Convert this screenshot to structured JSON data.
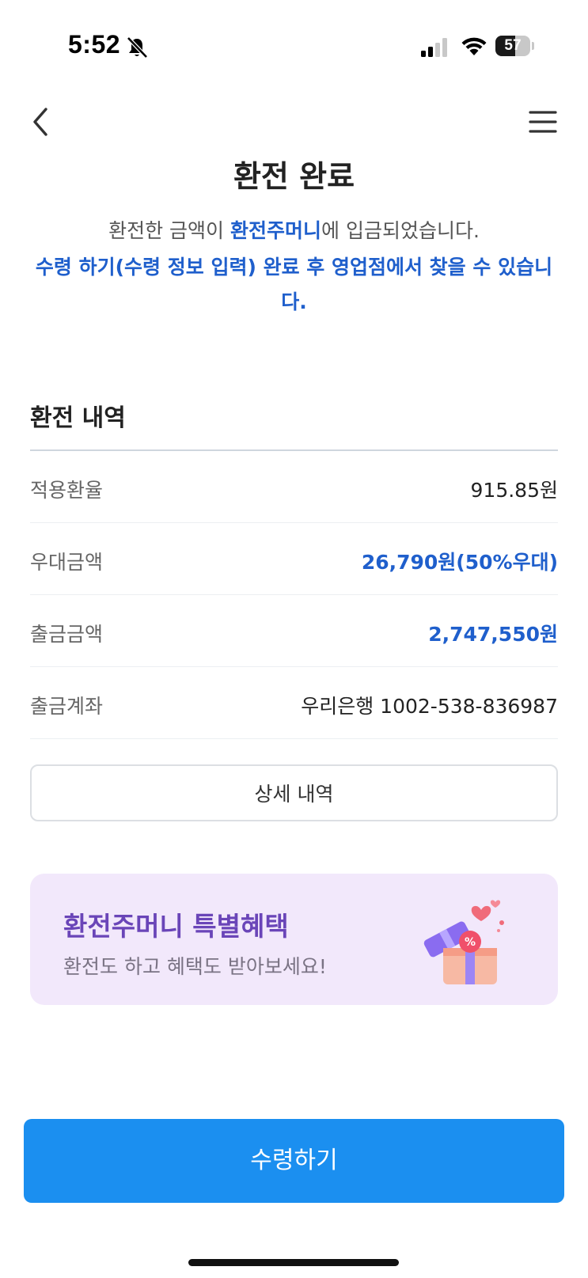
{
  "status_bar": {
    "time": "5:52",
    "battery": "57",
    "battery_level": 0.57
  },
  "header": {
    "title": "환전 완료"
  },
  "description": {
    "line1_prefix": "환전한 금액이 ",
    "line1_highlight": "환전주머니",
    "line1_suffix": "에 입금되었습니다.",
    "line2": "수령 하기(수령 정보 입력) 완료 후 영업점에서 찾을 수 있습니다."
  },
  "exchange_details": {
    "title": "환전 내역",
    "rows": [
      {
        "label": "적용환율",
        "value": "915.85원"
      },
      {
        "label": "우대금액",
        "value": "26,790원(50%우대)"
      },
      {
        "label": "출금금액",
        "value": "2,747,550원"
      },
      {
        "label": "출금계좌",
        "value": "우리은행 1002-538-836987"
      }
    ],
    "detail_button": "상세 내역"
  },
  "promo": {
    "title": "환전주머니 특별혜택",
    "subtitle": "환전도 하고 혜택도 받아보세요!",
    "icon": "gift-box-icon"
  },
  "footer": {
    "primary_button": "수령하기"
  },
  "colors": {
    "accent_blue": "#1f5fcc",
    "primary_button": "#1b8ff0",
    "promo_bg": "#f2e8fb",
    "promo_title": "#6a45b8"
  }
}
